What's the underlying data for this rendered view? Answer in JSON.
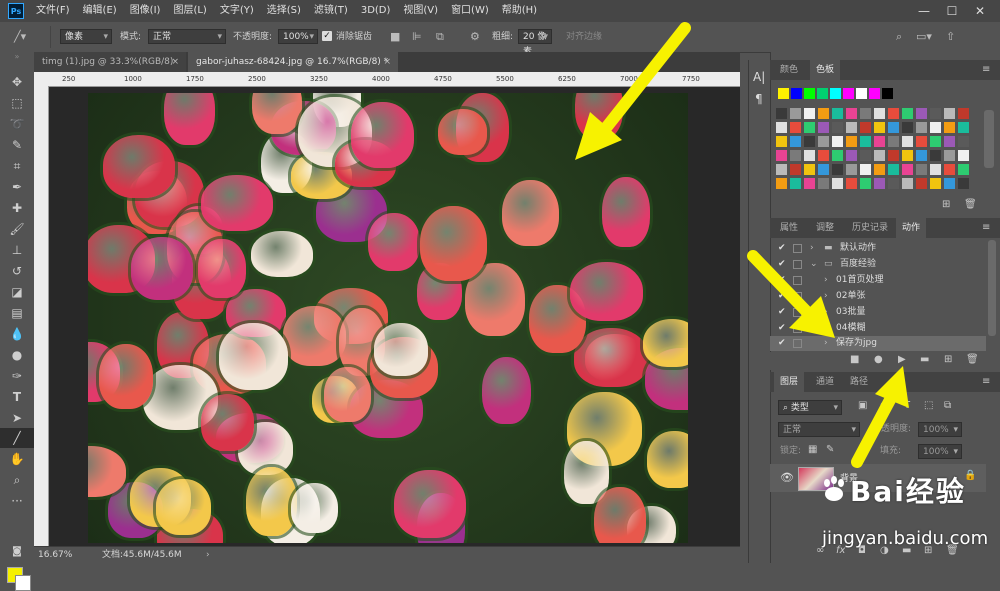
{
  "app": {
    "logo": "Ps"
  },
  "menubar": {
    "items": [
      "文件(F)",
      "编辑(E)",
      "图像(I)",
      "图层(L)",
      "文字(Y)",
      "选择(S)",
      "滤镜(T)",
      "3D(D)",
      "视图(V)",
      "窗口(W)",
      "帮助(H)"
    ],
    "window_controls": [
      "—",
      "☐",
      "✕"
    ]
  },
  "options_bar": {
    "mode_select": "像素",
    "mode_label": "模式:",
    "mode_value": "正常",
    "opacity_label": "不透明度:",
    "opacity_value": "100%",
    "antialias_label": "消除锯齿",
    "weight_label": "粗细:",
    "weight_value": "20 像素",
    "align_edges_label": "对齐边缘"
  },
  "tabs": [
    {
      "label": "timg (1).jpg @ 33.3%(RGB/8)",
      "close": "×"
    },
    {
      "label": "gabor-juhasz-68424.jpg @ 16.7%(RGB/8) *",
      "close": "×"
    }
  ],
  "ruler": {
    "top_ticks": [
      "250",
      "1000",
      "1750",
      "2500",
      "3250",
      "4000",
      "4750",
      "5500",
      "6250",
      "7000",
      "7750"
    ]
  },
  "statusbar": {
    "zoom": "16.67%",
    "doc_info": "文档:45.6M/45.6M"
  },
  "color_panel": {
    "tabs": [
      "颜色",
      "色板"
    ],
    "active_tab": "色板",
    "swatch_row1": [
      "#fff200",
      "#0000ff",
      "#00ff00",
      "#00d070",
      "#00ffff",
      "#ff00ff",
      "#ffffff",
      "#ff00ff",
      "#000000"
    ],
    "swatch_grid_colors": [
      "#3a3a3a",
      "#5a5a5a",
      "#7a7a7a",
      "#9a9a9a",
      "#bababa",
      "#e0e0e0",
      "#f0f0f0",
      "#c0392b",
      "#e74c3c",
      "#f39c12",
      "#f1c40f",
      "#2ecc71",
      "#1abc9c",
      "#3498db",
      "#9b59b6",
      "#e84393"
    ]
  },
  "actions_panel": {
    "tabs": [
      "属性",
      "调整",
      "历史记录",
      "动作"
    ],
    "active_tab": "动作",
    "items": [
      {
        "label": "默认动作",
        "check": "✔",
        "indent": 0
      },
      {
        "label": "百度经验",
        "check": "✔",
        "indent": 0
      },
      {
        "label": "01首页处理",
        "check": "✔",
        "indent": 1
      },
      {
        "label": "02单张",
        "check": "✔",
        "indent": 1
      },
      {
        "label": "03批量",
        "check": "✔",
        "indent": 1
      },
      {
        "label": "04模糊",
        "check": "✔",
        "indent": 1
      },
      {
        "label": "保存为jpg",
        "check": "✔",
        "indent": 1
      }
    ]
  },
  "layers_panel": {
    "tabs": [
      "图层",
      "通道",
      "路径"
    ],
    "active_tab": "图层",
    "filter_label": "类型",
    "blend_mode": "正常",
    "opacity_label": "不透明度:",
    "opacity_value": "100%",
    "lock_label": "锁定:",
    "fill_label": "填充:",
    "fill_value": "100%",
    "layer_name": "背景"
  },
  "watermark": {
    "text": "Bai经验",
    "url": "jingyan.baidu.com"
  }
}
